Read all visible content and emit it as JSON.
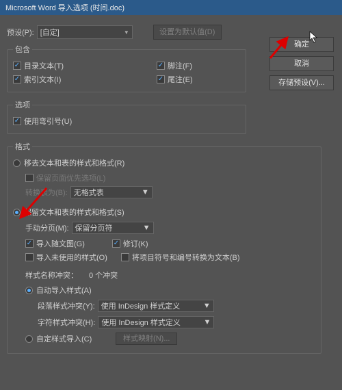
{
  "title": "Microsoft Word 导入选项 (时间.doc)",
  "preset": {
    "label": "预设(P):",
    "value": "[自定]",
    "setDefault": "设置为默认值(D)"
  },
  "buttons": {
    "ok": "确定",
    "cancel": "取消",
    "savePreset": "存储预设(V)..."
  },
  "include": {
    "legend": "包含",
    "tocText": "目录文本(T)",
    "indexText": "索引文本(I)",
    "footnotes": "脚注(F)",
    "endnotes": "尾注(E)"
  },
  "options": {
    "legend": "选项",
    "useTypographersQuotes": "使用弯引号(U)"
  },
  "formatting": {
    "legend": "格式",
    "removeStyles": "移去文本和表的样式和格式(R)",
    "preservePageOverrides": "保留页面优先选项(L)",
    "convertTablesLabel": "转换表为(B):",
    "convertTablesValue": "无格式表",
    "preserveStyles": "保留文本和表的样式和格式(S)",
    "manualBreaksLabel": "手动分页(M):",
    "manualBreaksValue": "保留分页符",
    "importInline": "导入随文图(G)",
    "trackChanges": "修订(K)",
    "importUnused": "导入未使用的样式(O)",
    "convertBullets": "将项目符号和编号转换为文本(B)",
    "conflictsLabel": "样式名称冲突：",
    "conflictsCount": "0 个冲突",
    "autoImport": "自动导入样式(A)",
    "paraConflictLabel": "段落样式冲突(Y):",
    "paraConflictValue": "使用 InDesign 样式定义",
    "charConflictLabel": "字符样式冲突(H):",
    "charConflictValue": "使用 InDesign 样式定义",
    "customImport": "自定样式导入(C)",
    "styleMapping": "样式映射(N)..."
  }
}
